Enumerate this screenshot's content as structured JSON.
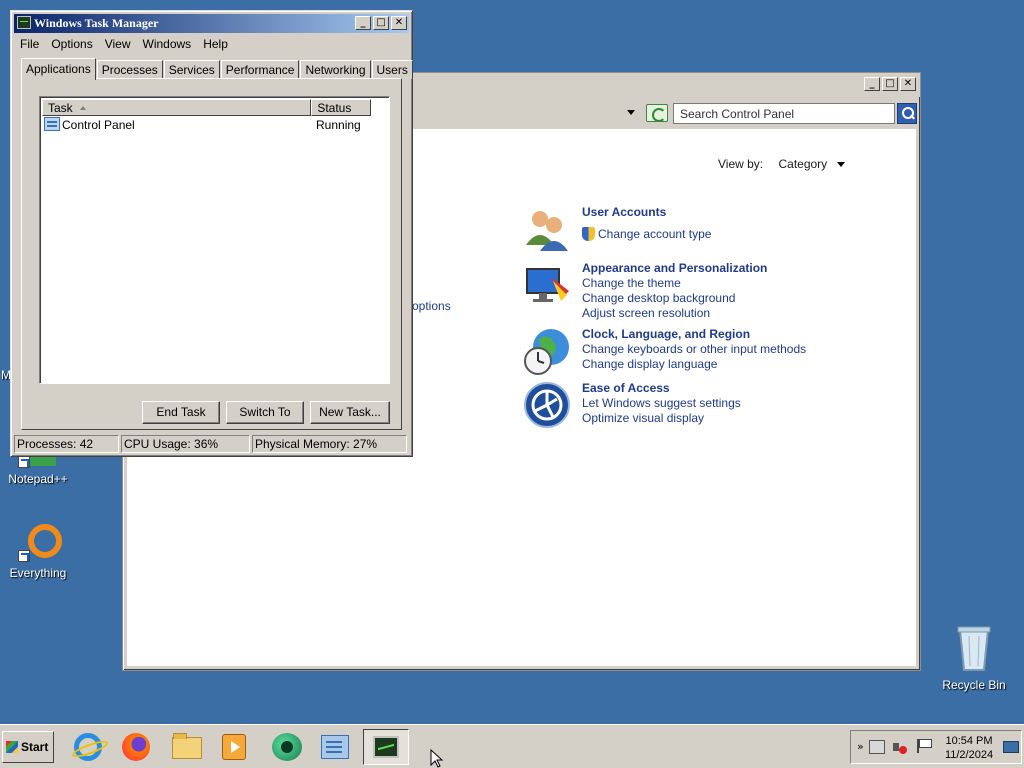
{
  "desktop": {
    "icons": [
      {
        "label": "Notepad++"
      },
      {
        "label": "Everything"
      },
      {
        "label": "Recycle Bin"
      }
    ],
    "partial_left_letter": "M"
  },
  "control_panel": {
    "search_placeholder": "Search Control Panel",
    "view_by_label": "View by:",
    "view_by_value": "Category",
    "partial_link": "options",
    "categories": [
      {
        "icon": "user-accounts-icon",
        "heading": "User Accounts",
        "links": [
          "Change account type"
        ],
        "first_link_has_shield": true
      },
      {
        "icon": "appearance-icon",
        "heading": "Appearance and Personalization",
        "links": [
          "Change the theme",
          "Change desktop background",
          "Adjust screen resolution"
        ]
      },
      {
        "icon": "clock-globe-icon",
        "heading": "Clock, Language, and Region",
        "links": [
          "Change keyboards or other input methods",
          "Change display language"
        ]
      },
      {
        "icon": "ease-of-access-icon",
        "heading": "Ease of Access",
        "links": [
          "Let Windows suggest settings",
          "Optimize visual display"
        ]
      }
    ]
  },
  "task_manager": {
    "title": "Windows Task Manager",
    "menu": [
      "File",
      "Options",
      "View",
      "Windows",
      "Help"
    ],
    "tabs": [
      "Applications",
      "Processes",
      "Services",
      "Performance",
      "Networking",
      "Users"
    ],
    "active_tab": "Applications",
    "columns": {
      "task": "Task",
      "status": "Status"
    },
    "rows": [
      {
        "task": "Control Panel",
        "status": "Running"
      }
    ],
    "buttons": {
      "end_task": "End Task",
      "switch_to": "Switch To",
      "new_task": "New Task..."
    },
    "status_bar": {
      "processes": "Processes: 42",
      "cpu": "CPU Usage: 36%",
      "memory": "Physical Memory: 27%"
    }
  },
  "taskbar": {
    "start_label": "Start",
    "pinned": [
      "internet-explorer-icon",
      "firefox-icon",
      "file-explorer-icon",
      "media-player-icon",
      "green-app-icon",
      "control-panel-icon",
      "task-manager-icon"
    ],
    "active_item": "task-manager-icon",
    "clock": {
      "time": "10:54 PM",
      "date": "11/2/2024"
    },
    "tray_chevron": "»"
  },
  "window_buttons": {
    "minimize": "_",
    "maximize": "□",
    "close": "✕"
  }
}
